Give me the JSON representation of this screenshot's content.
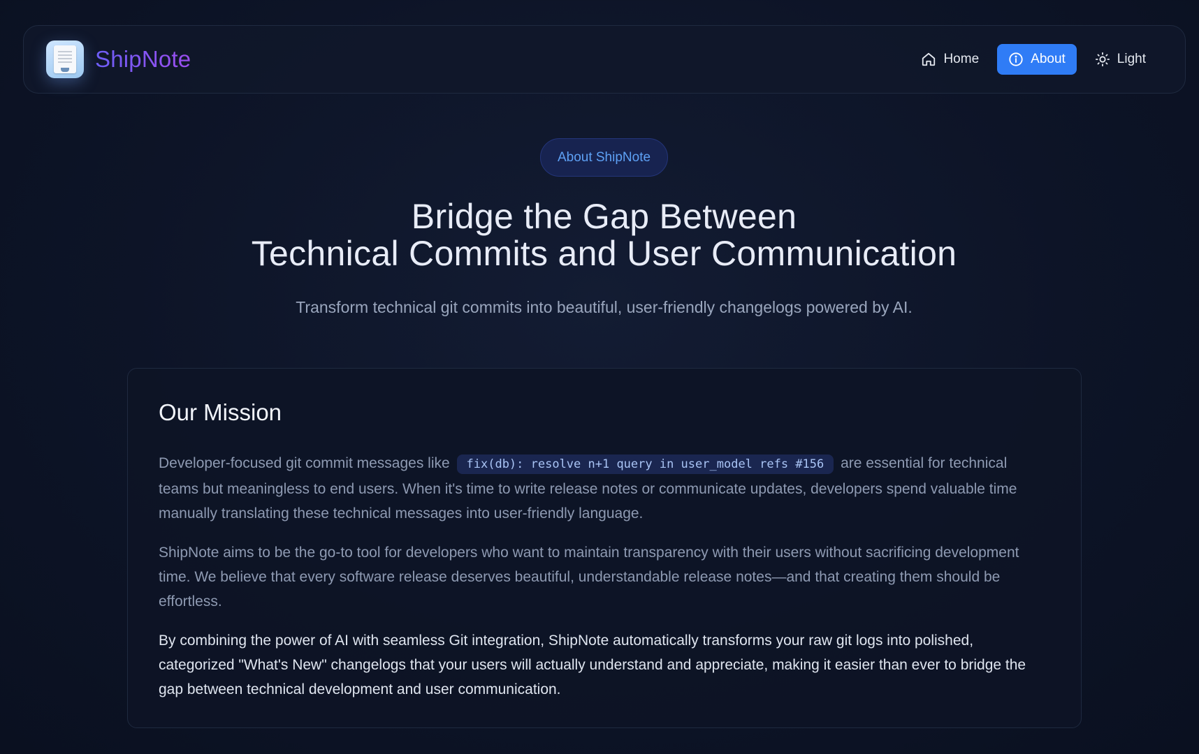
{
  "header": {
    "brand_name": "ShipNote",
    "nav": [
      {
        "label": "Home",
        "icon": "home-icon"
      },
      {
        "label": "About",
        "icon": "info-icon",
        "active": true
      },
      {
        "label": "Light",
        "icon": "sun-icon"
      }
    ]
  },
  "hero": {
    "badge": "About ShipNote",
    "title_line1": "Bridge the Gap Between",
    "title_line2": "Technical Commits and User Communication",
    "subtitle": "Transform technical git commits into beautiful, user-friendly changelogs powered by AI."
  },
  "mission": {
    "title": "Our Mission",
    "p1_before": "Developer-focused git commit messages like",
    "p1_code": "fix(db): resolve n+1 query in user_model refs #156",
    "p1_after": "are essential for technical teams but meaningless to end users. When it's time to write release notes or communicate updates, developers spend valuable time manually translating these technical messages into user-friendly language.",
    "p2": "ShipNote aims to be the go-to tool for developers who want to maintain transparency with their users without sacrificing development time. We believe that every software release deserves beautiful, understandable release notes—and that creating them should be effortless.",
    "p3": "By combining the power of AI with seamless Git integration, ShipNote automatically transforms your raw git logs into polished, categorized \"What's New\" changelogs that your users will actually understand and appreciate, making it easier than ever to bridge the gap between technical development and user communication."
  },
  "colors": {
    "accent": "#2f7cf6",
    "badge_text": "#5ea1f5",
    "brand_gradient_start": "#6d5ef7",
    "brand_gradient_end": "#9b4dee",
    "background": "#0d1427"
  }
}
